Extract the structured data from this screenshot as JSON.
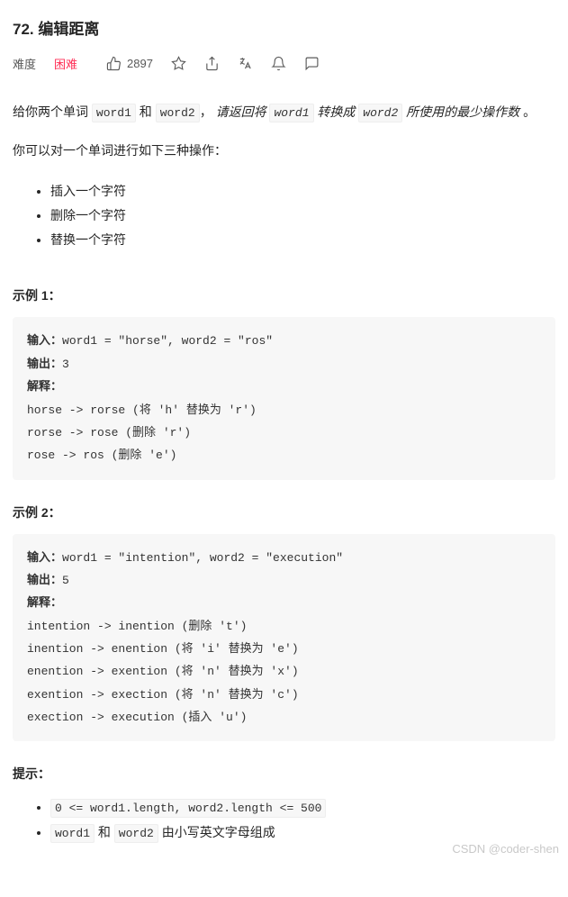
{
  "title": "72. 编辑距离",
  "meta": {
    "difficulty_label": "难度",
    "difficulty_value": "困难",
    "likes": "2897"
  },
  "description": {
    "line1_a": "给你两个单词 ",
    "code1": "word1",
    "line1_b": " 和 ",
    "code2": "word2",
    "line1_c": "， ",
    "italic_a": "请返回将 ",
    "code3": "word1",
    "italic_b": " 转换成 ",
    "code4": "word2",
    "italic_c": " 所使用的最少操作数",
    "line1_d": " 。",
    "line2": "你可以对一个单词进行如下三种操作："
  },
  "operations": [
    "插入一个字符",
    "删除一个字符",
    "替换一个字符"
  ],
  "example1": {
    "heading": "示例 1：",
    "input_label": "输入：",
    "input_value": "word1 = \"horse\", word2 = \"ros\"",
    "output_label": "输出：",
    "output_value": "3",
    "explain_label": "解释：",
    "step1": "horse -> rorse (将 'h' 替换为 'r')",
    "step2": "rorse -> rose (删除 'r')",
    "step3": "rose -> ros (删除 'e')"
  },
  "example2": {
    "heading": "示例 2：",
    "input_label": "输入：",
    "input_value": "word1 = \"intention\", word2 = \"execution\"",
    "output_label": "输出：",
    "output_value": "5",
    "explain_label": "解释：",
    "step1": "intention -> inention (删除 't')",
    "step2": "inention -> enention (将 'i' 替换为 'e')",
    "step3": "enention -> exention (将 'n' 替换为 'x')",
    "step4": "exention -> exection (将 'n' 替换为 'c')",
    "step5": "exection -> execution (插入 'u')"
  },
  "constraints": {
    "heading": "提示：",
    "c1": "0 <= word1.length, word2.length <= 500",
    "c2_a": "word1",
    "c2_b": " 和 ",
    "c2_c": "word2",
    "c2_d": " 由小写英文字母组成"
  },
  "watermark": "CSDN @coder-shen"
}
